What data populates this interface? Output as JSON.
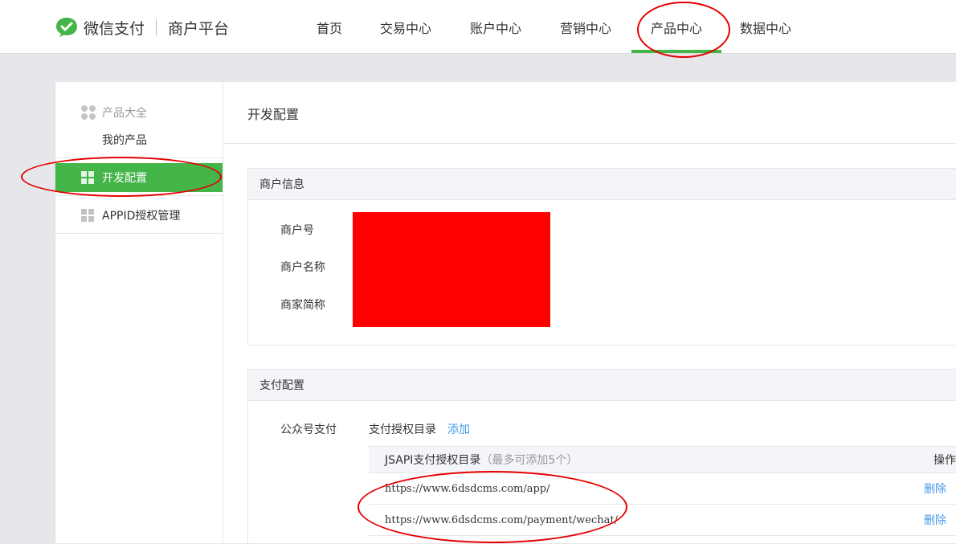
{
  "header": {
    "brand": "微信支付",
    "subtitle": "商户平台",
    "nav": [
      "首页",
      "交易中心",
      "账户中心",
      "营销中心",
      "产品中心",
      "数据中心"
    ],
    "active_nav": "产品中心",
    "accent": "#44b549"
  },
  "sidebar": {
    "group_label": "产品大全",
    "sub_item": "我的产品",
    "active_item": "开发配置",
    "item": "APPID授权管理"
  },
  "main": {
    "page_title": "开发配置",
    "merchant_info": {
      "title": "商户信息",
      "fields": [
        "商户号",
        "商户名称",
        "商家简称"
      ]
    },
    "pay_config": {
      "title": "支付配置",
      "label": "公众号支付",
      "dir_label": "支付授权目录",
      "add_link": "添加",
      "table_header": "JSAPI支付授权目录",
      "table_hint": "（最多可添加5个）",
      "op_header": "操作",
      "rows": [
        {
          "url": "https://www.6dsdcms.com/app/",
          "action": "删除"
        },
        {
          "url": "https://www.6dsdcms.com/payment/wechat/",
          "action": "删除"
        }
      ]
    }
  },
  "colors": {
    "redaction": "#ff0000",
    "annotation": "#e60000",
    "link": "#459ae9"
  }
}
